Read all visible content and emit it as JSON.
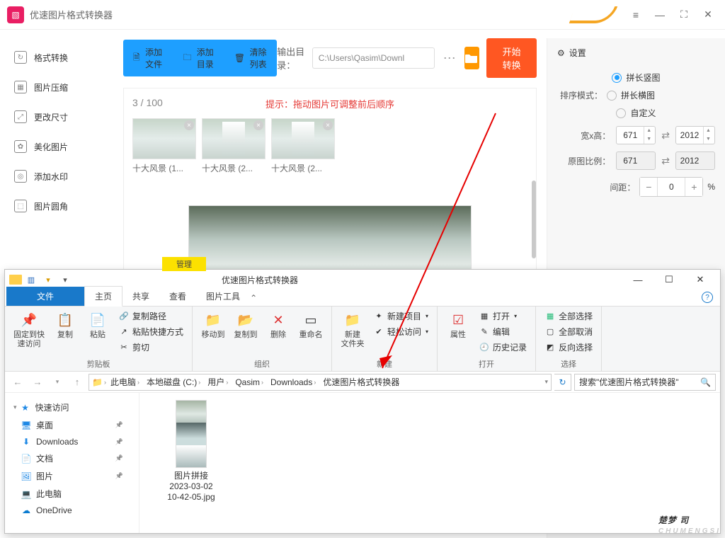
{
  "app": {
    "title": "优速图片格式转换器",
    "window_buttons": {
      "menu": "≡",
      "min": "—",
      "max": "⛶",
      "close": "✕"
    },
    "sidebar": [
      {
        "icon": "↻",
        "label": "格式转换"
      },
      {
        "icon": "▦",
        "label": "图片压缩"
      },
      {
        "icon": "⤢",
        "label": "更改尺寸"
      },
      {
        "icon": "✿",
        "label": "美化图片"
      },
      {
        "icon": "◎",
        "label": "添加水印"
      },
      {
        "icon": "⬚",
        "label": "图片圆角"
      }
    ],
    "toolbar": {
      "add_file": "添加文件",
      "add_dir": "添加目录",
      "clear": "清除列表",
      "out_label": "输出目录：",
      "out_path": "C:\\Users\\Qasim\\Downl",
      "start": "开始转换"
    },
    "stage": {
      "count": "3 / 100",
      "hint": "提示：拖动图片可调整前后顺序",
      "thumbs": [
        "十大风景 (1...",
        "十大风景 (2...",
        "十大风景 (2..."
      ]
    },
    "panel": {
      "header": "设置",
      "mode_label": "排序模式：",
      "modes": [
        "拼长竖图",
        "拼长横图",
        "自定义"
      ],
      "mode_selected": 0,
      "size_label": "宽x高：",
      "w": "671",
      "h": "2012",
      "ratio_label": "原图比例：",
      "rw": "671",
      "rh": "2012",
      "gap_label": "间距：",
      "gap": "0",
      "gap_unit": "%"
    }
  },
  "explorer": {
    "title": "优速图片格式转换器",
    "context_tab": "管理",
    "tabs": {
      "file": "文件",
      "home": "主页",
      "share": "共享",
      "view": "查看",
      "pic": "图片工具"
    },
    "ribbon": {
      "g1": {
        "pin": "固定到快\n速访问",
        "copy": "复制",
        "paste": "粘贴",
        "copypath": "复制路径",
        "pasteshortcut": "粘贴快捷方式",
        "cut": "剪切",
        "label": "剪贴板"
      },
      "g2": {
        "moveto": "移动到",
        "copyto": "复制到",
        "delete": "删除",
        "rename": "重命名",
        "label": "组织"
      },
      "g3": {
        "newfolder": "新建\n文件夹",
        "newitem": "新建项目",
        "easyaccess": "轻松访问",
        "label": "新建"
      },
      "g4": {
        "props": "属性",
        "open": "打开",
        "edit": "编辑",
        "history": "历史记录",
        "label": "打开"
      },
      "g5": {
        "selectall": "全部选择",
        "selectnone": "全部取消",
        "invert": "反向选择",
        "label": "选择"
      }
    },
    "breadcrumbs": [
      "此电脑",
      "本地磁盘 (C:)",
      "用户",
      "Qasim",
      "Downloads",
      "优速图片格式转换器"
    ],
    "search_placeholder": "搜索\"优速图片格式转换器\"",
    "tree": [
      {
        "ico": "★",
        "label": "快速访问",
        "color": "#1e88e5"
      },
      {
        "ico": "🖥",
        "label": "桌面",
        "pin": true
      },
      {
        "ico": "⬇",
        "label": "Downloads",
        "pin": true
      },
      {
        "ico": "📄",
        "label": "文档",
        "pin": true
      },
      {
        "ico": "🖼",
        "label": "图片",
        "pin": true
      },
      {
        "ico": "💻",
        "label": "此电脑"
      },
      {
        "ico": "☁",
        "label": "OneDrive",
        "color": "#0a7bd0"
      }
    ],
    "file": {
      "name": "图片拼接",
      "line2": "2023-03-02",
      "line3": "10-42-05.jpg"
    }
  },
  "watermark": {
    "big": "楚梦 司",
    "small": "CHUMENGSI"
  }
}
